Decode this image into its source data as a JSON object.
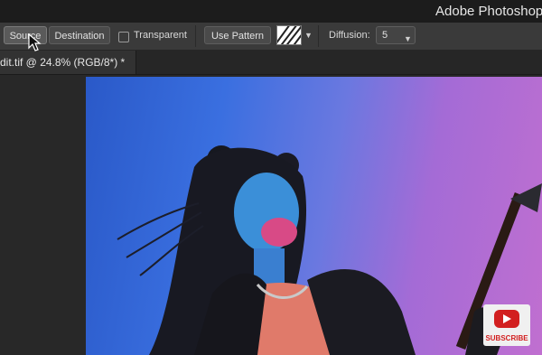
{
  "titlebar": {
    "app_title": "Adobe Photoshop"
  },
  "options": {
    "source_label": "Source",
    "destination_label": "Destination",
    "transparent_label": "Transparent",
    "use_pattern_label": "Use Pattern",
    "diffusion_label": "Diffusion:",
    "diffusion_value": "5"
  },
  "document": {
    "tab_label": "dit.tif @ 24.8% (RGB/8*) *"
  },
  "overlay": {
    "subscribe_label": "SUBSCRIBE"
  },
  "colors": {
    "canvas_left": "#2a59c8",
    "canvas_right": "#c06fd0",
    "subscribe_red": "#d21f1f"
  },
  "icons": {
    "cursor": "arrow-cursor-icon",
    "dropdown": "chevron-down-icon",
    "play": "youtube-play-icon"
  }
}
